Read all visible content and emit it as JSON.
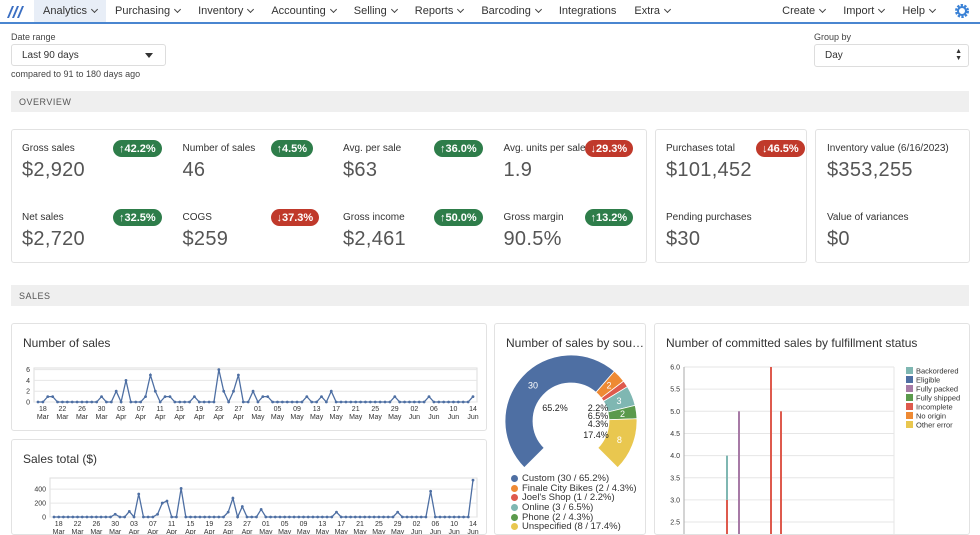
{
  "nav": {
    "items": [
      "Analytics",
      "Purchasing",
      "Inventory",
      "Accounting",
      "Selling",
      "Reports",
      "Barcoding",
      "Integrations",
      "Extra"
    ],
    "has_chevron": [
      true,
      true,
      true,
      true,
      true,
      true,
      true,
      false,
      true
    ],
    "right": [
      "Create",
      "Import",
      "Help"
    ],
    "accent": "#4a86d0"
  },
  "filters": {
    "date_label": "Date range",
    "date_value": "Last 90 days",
    "compare_text": "compared to 91 to 180 days ago",
    "group_label": "Group by",
    "group_value": "Day"
  },
  "overview": {
    "title": "OVERVIEW",
    "kpis": [
      {
        "label": "Gross sales",
        "value": "$2,920",
        "change": "↑42.2%",
        "dir": "up"
      },
      {
        "label": "Number of sales",
        "value": "46",
        "change": "↑4.5%",
        "dir": "up"
      },
      {
        "label": "Avg. per sale",
        "value": "$63",
        "change": "↑36.0%",
        "dir": "up"
      },
      {
        "label": "Avg. units per sale",
        "value": "1.9",
        "change": "↓29.3%",
        "dir": "down"
      },
      {
        "label": "Net sales",
        "value": "$2,720",
        "change": "↑32.5%",
        "dir": "up"
      },
      {
        "label": "COGS",
        "value": "$259",
        "change": "↓37.3%",
        "dir": "down"
      },
      {
        "label": "Gross income",
        "value": "$2,461",
        "change": "↑50.0%",
        "dir": "up"
      },
      {
        "label": "Gross margin",
        "value": "90.5%",
        "change": "↑13.2%",
        "dir": "up"
      }
    ],
    "purchases": [
      {
        "label": "Purchases total",
        "value": "$101,452",
        "change": "↓46.5%",
        "dir": "down"
      },
      {
        "label": "Pending purchases",
        "value": "$30"
      }
    ],
    "inventory": [
      {
        "label": "Inventory value (6/16/2023)",
        "value": "$353,255"
      },
      {
        "label": "Value of variances",
        "value": "$0"
      }
    ],
    "colors": {
      "up": "#2e7d4a",
      "down": "#c0392b"
    }
  },
  "sales": {
    "title": "SALES"
  },
  "chart_data": [
    {
      "type": "line",
      "title": "Number of sales",
      "start_date": "2023-03-17",
      "x_ticks": [
        "18 Mar",
        "22 Mar",
        "26 Mar",
        "30 Mar",
        "03 Apr",
        "07 Apr",
        "11 Apr",
        "15 Apr",
        "19 Apr",
        "23 Apr",
        "27 Apr",
        "01 May",
        "05 May",
        "09 May",
        "13 May",
        "17 May",
        "21 May",
        "25 May",
        "29 May",
        "02 Jun",
        "06 Jun",
        "10 Jun",
        "14 Jun"
      ],
      "y_ticks": [
        0,
        2,
        4,
        6
      ],
      "ylim": [
        0,
        6.3
      ],
      "color": "#4e6fa3",
      "values": [
        0,
        0,
        1,
        1,
        0,
        0,
        0,
        0,
        0,
        0,
        0,
        0,
        0,
        1,
        0,
        0,
        2,
        0,
        4,
        0,
        0,
        0,
        1,
        5,
        2,
        0,
        1,
        1,
        0,
        0,
        0,
        0,
        1,
        0,
        0,
        0,
        0,
        6,
        2,
        0,
        2,
        5,
        0,
        0,
        2,
        0,
        1,
        1,
        0,
        0,
        0,
        0,
        0,
        0,
        0,
        1,
        0,
        0,
        1,
        0,
        2,
        0,
        0,
        0,
        0,
        0,
        0,
        0,
        0,
        0,
        0,
        0,
        0,
        1,
        0,
        0,
        0,
        0,
        0,
        0,
        1,
        0,
        0,
        0,
        0,
        0,
        0,
        0,
        0,
        1
      ]
    },
    {
      "type": "line",
      "title": "Sales total ($)",
      "start_date": "2023-03-17",
      "x_ticks": [
        "18 Mar",
        "22 Mar",
        "26 Mar",
        "30 Mar",
        "03 Apr",
        "07 Apr",
        "11 Apr",
        "15 Apr",
        "19 Apr",
        "23 Apr",
        "27 Apr",
        "01 May",
        "05 May",
        "09 May",
        "13 May",
        "17 May",
        "21 May",
        "25 May",
        "29 May",
        "02 Jun",
        "06 Jun",
        "10 Jun",
        "14 Jun"
      ],
      "y_ticks": [
        0,
        200,
        400
      ],
      "ylim": [
        0,
        560
      ],
      "color": "#4e6fa3",
      "values": [
        0,
        0,
        0,
        0,
        0,
        0,
        0,
        0,
        0,
        0,
        0,
        0,
        0,
        40,
        0,
        0,
        80,
        0,
        330,
        0,
        0,
        0,
        40,
        200,
        230,
        0,
        0,
        410,
        0,
        0,
        0,
        0,
        0,
        0,
        0,
        0,
        0,
        70,
        270,
        0,
        150,
        0,
        0,
        0,
        110,
        0,
        0,
        0,
        0,
        0,
        0,
        0,
        0,
        0,
        0,
        0,
        0,
        0,
        0,
        0,
        70,
        0,
        0,
        0,
        0,
        0,
        0,
        0,
        0,
        0,
        0,
        0,
        0,
        70,
        0,
        0,
        0,
        0,
        0,
        0,
        370,
        0,
        0,
        0,
        0,
        0,
        0,
        0,
        0,
        530
      ]
    },
    {
      "type": "pie",
      "title": "Number of sales by sou…",
      "slices": [
        {
          "name": "Custom",
          "value": 30,
          "pct": "65.2%",
          "legend": "Custom (30 / 65.2%)",
          "color": "#4e6fa3"
        },
        {
          "name": "Finale City Bikes",
          "value": 2,
          "pct": "4.3%",
          "legend": "Finale City Bikes (2 / 4.3%)",
          "color": "#ee8a34"
        },
        {
          "name": "Joel's Shop",
          "value": 1,
          "pct": "2.2%",
          "legend": "Joel's Shop (1 / 2.2%)",
          "color": "#de5a4d"
        },
        {
          "name": "Online",
          "value": 3,
          "pct": "6.5%",
          "legend": "Online (3 / 6.5%)",
          "color": "#7fb7b2"
        },
        {
          "name": "Phone",
          "value": 2,
          "pct": "4.3%",
          "legend": "Phone (2 / 4.3%)",
          "color": "#5b9a4c"
        },
        {
          "name": "Unspecified",
          "value": 8,
          "pct": "17.4%",
          "legend": "Unspecified (8 / 17.4%)",
          "color": "#e9c74f"
        }
      ]
    },
    {
      "type": "bar",
      "stacked": true,
      "title": "Number of committed sales by fulfillment status",
      "y_ticks": [
        "2.5",
        "3.0",
        "3.5",
        "4.0",
        "4.5",
        "5.0",
        "5.5",
        "6.0"
      ],
      "ylim_visible": [
        2.5,
        6.0
      ],
      "legend": [
        {
          "name": "Backordered",
          "color": "#7fb7b2"
        },
        {
          "name": "Eligible",
          "color": "#4e6fa3"
        },
        {
          "name": "Fully packed",
          "color": "#a77aa6"
        },
        {
          "name": "Fully shipped",
          "color": "#5b9a4c"
        },
        {
          "name": "Incomplete",
          "color": "#de5a4d"
        },
        {
          "name": "No origin",
          "color": "#ee8a34"
        },
        {
          "name": "Other error",
          "color": "#e9c74f"
        }
      ],
      "bars": [
        [
          {
            "status": "Incomplete",
            "value": 3
          },
          {
            "status": "Backordered",
            "value": 1
          }
        ],
        [
          {
            "status": "Fully packed",
            "value": 5
          }
        ],
        [
          {
            "status": "Incomplete",
            "value": 6
          }
        ],
        [
          {
            "status": "Incomplete",
            "value": 5
          }
        ]
      ]
    }
  ]
}
